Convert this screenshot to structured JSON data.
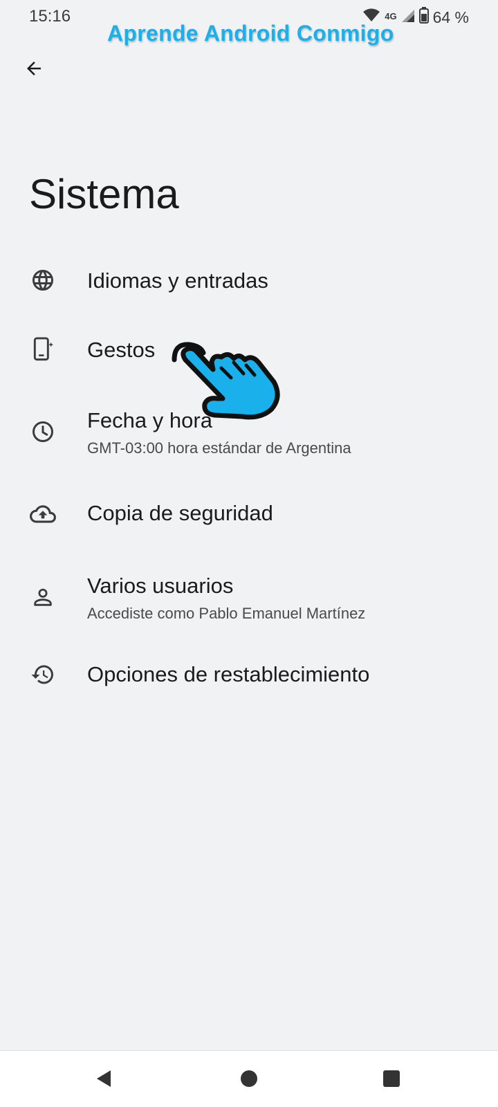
{
  "status_bar": {
    "time": "15:16",
    "network": "4G",
    "battery": "64 %"
  },
  "watermark": "Aprende Android Conmigo",
  "header": {
    "back_icon": "arrow-back-icon"
  },
  "page": {
    "title": "Sistema"
  },
  "items": [
    {
      "icon": "globe-icon",
      "title": "Idiomas y entradas",
      "subtitle": ""
    },
    {
      "icon": "phone-gesture-icon",
      "title": "Gestos",
      "subtitle": ""
    },
    {
      "icon": "clock-icon",
      "title": "Fecha y hora",
      "subtitle": "GMT-03:00 hora estándar de Argentina"
    },
    {
      "icon": "cloud-upload-icon",
      "title": "Copia de seguridad",
      "subtitle": ""
    },
    {
      "icon": "person-icon",
      "title": "Varios usuarios",
      "subtitle": "Accediste como Pablo Emanuel Martínez"
    },
    {
      "icon": "history-icon",
      "title": "Opciones de restablecimiento",
      "subtitle": ""
    }
  ],
  "nav_bar": {
    "back": "nav-back-icon",
    "home": "nav-home-icon",
    "recents": "nav-recents-icon"
  },
  "colors": {
    "background": "#f1f2f4",
    "watermark": "#19b0ec",
    "pointer_fill": "#19b0ec"
  }
}
